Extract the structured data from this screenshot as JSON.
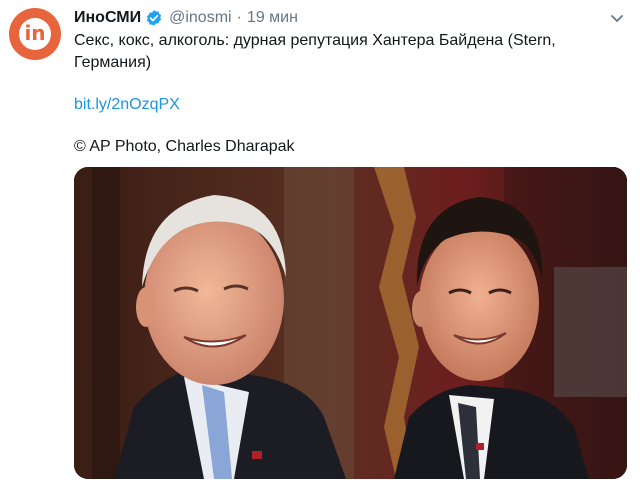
{
  "tweet": {
    "display_name": "ИноСМИ",
    "handle": "@inosmi",
    "separator": "·",
    "time": "19 мин",
    "text": "Секс, кокс, алкоголь: дурная репутация Хантера Байдена (Stern, Германия)",
    "link": "bit.ly/2nOzqPX",
    "credit": "© AP Photo, Charles Dharapak",
    "avatar_letter": "in"
  },
  "icons": {
    "avatar": "inosmi-logo-icon",
    "verified": "verified-badge-icon",
    "menu": "chevron-down-icon"
  },
  "colors": {
    "link": "#1b95e0",
    "verified": "#1da1f2",
    "avatar_bg": "#e8643c",
    "secondary_text": "#657786"
  }
}
